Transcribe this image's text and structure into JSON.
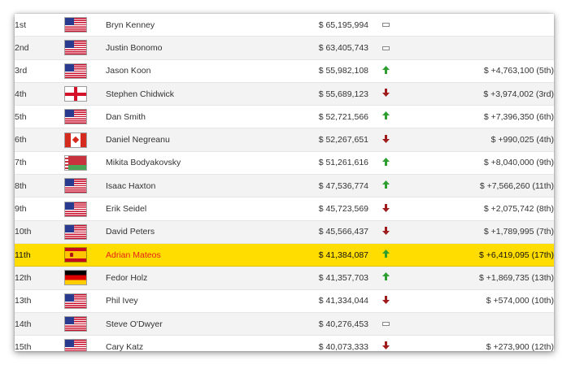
{
  "rows": [
    {
      "rank": "1st",
      "flag": "us-flag-icon",
      "name": "Bryn Kenney",
      "earnings": "$ 65,195,994",
      "trend": "unchanged",
      "change": ""
    },
    {
      "rank": "2nd",
      "flag": "us-flag-icon",
      "name": "Justin Bonomo",
      "earnings": "$ 63,405,743",
      "trend": "unchanged",
      "change": ""
    },
    {
      "rank": "3rd",
      "flag": "us-flag-icon",
      "name": "Jason Koon",
      "earnings": "$ 55,982,108",
      "trend": "up",
      "change": "$ +4,763,100 (5th)"
    },
    {
      "rank": "4th",
      "flag": "england-flag-icon",
      "name": "Stephen Chidwick",
      "earnings": "$ 55,689,123",
      "trend": "down",
      "change": "$ +3,974,002 (3rd)"
    },
    {
      "rank": "5th",
      "flag": "us-flag-icon",
      "name": "Dan Smith",
      "earnings": "$ 52,721,566",
      "trend": "up",
      "change": "$ +7,396,350 (6th)"
    },
    {
      "rank": "6th",
      "flag": "canada-flag-icon",
      "name": "Daniel Negreanu",
      "earnings": "$ 52,267,651",
      "trend": "down",
      "change": "$ +990,025 (4th)"
    },
    {
      "rank": "7th",
      "flag": "belarus-flag-icon",
      "name": "Mikita Bodyakovsky",
      "earnings": "$ 51,261,616",
      "trend": "up",
      "change": "$ +8,040,000 (9th)"
    },
    {
      "rank": "8th",
      "flag": "us-flag-icon",
      "name": "Isaac Haxton",
      "earnings": "$ 47,536,774",
      "trend": "up",
      "change": "$ +7,566,260 (11th)"
    },
    {
      "rank": "9th",
      "flag": "us-flag-icon",
      "name": "Erik Seidel",
      "earnings": "$ 45,723,569",
      "trend": "down",
      "change": "$ +2,075,742 (8th)"
    },
    {
      "rank": "10th",
      "flag": "us-flag-icon",
      "name": "David Peters",
      "earnings": "$ 45,566,437",
      "trend": "down",
      "change": "$ +1,789,995 (7th)"
    },
    {
      "rank": "11th",
      "flag": "spain-flag-icon",
      "name": "Adrian Mateos",
      "earnings": "$ 41,384,087",
      "trend": "up",
      "change": "$ +6,419,095 (17th)",
      "highlight": true
    },
    {
      "rank": "12th",
      "flag": "germany-flag-icon",
      "name": "Fedor Holz",
      "earnings": "$ 41,357,703",
      "trend": "up",
      "change": "$ +1,869,735 (13th)"
    },
    {
      "rank": "13th",
      "flag": "us-flag-icon",
      "name": "Phil Ivey",
      "earnings": "$ 41,334,044",
      "trend": "down",
      "change": "$ +574,000 (10th)"
    },
    {
      "rank": "14th",
      "flag": "us-flag-icon",
      "name": "Steve O'Dwyer",
      "earnings": "$ 40,276,453",
      "trend": "unchanged",
      "change": ""
    },
    {
      "rank": "15th",
      "flag": "us-flag-icon",
      "name": "Cary Katz",
      "earnings": "$ 40,073,333",
      "trend": "down",
      "change": "$ +273,900 (12th)"
    }
  ],
  "colors": {
    "player_link": "#2f7fd8",
    "highlight_row": "#ffdd00",
    "highlight_name": "#e8211b",
    "trend_up": "#2e9e2e",
    "trend_down": "#9e1c1c"
  }
}
